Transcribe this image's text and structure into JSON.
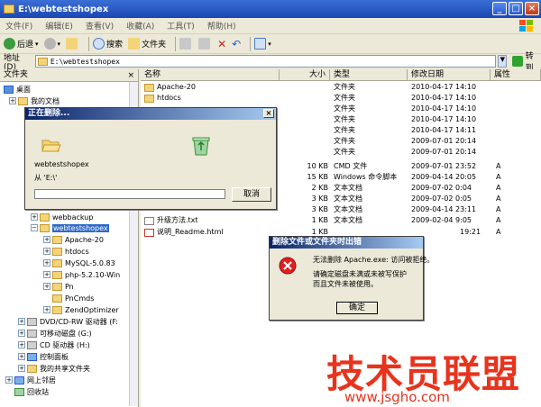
{
  "window": {
    "title": "E:\\webtestshopex"
  },
  "menu": [
    "文件(F)",
    "编辑(E)",
    "查看(V)",
    "收藏(A)",
    "工具(T)",
    "帮助(H)"
  ],
  "toolbar": {
    "back": "后退",
    "search": "搜索",
    "folders": "文件夹"
  },
  "address": {
    "label": "地址(D)",
    "value": "E:\\webtestshopex",
    "go": "转到"
  },
  "folders_pane": {
    "header": "文件夹",
    "items": [
      {
        "label": "桌面"
      },
      {
        "label": "我的文档"
      },
      {
        "label": "webbackup"
      },
      {
        "label": "webtestshopex"
      },
      {
        "label": "Apache-20"
      },
      {
        "label": "htdocs"
      },
      {
        "label": "MySQL-5.0.83"
      },
      {
        "label": "php-5.2.10-Win"
      },
      {
        "label": "Pn"
      },
      {
        "label": "PnCmds"
      },
      {
        "label": "ZendOptimizer"
      },
      {
        "label": "DVD/CD-RW 驱动器 (F:"
      },
      {
        "label": "可移动磁盘 (G:)"
      },
      {
        "label": "CD 驱动器 (H:)"
      },
      {
        "label": "控制面板"
      },
      {
        "label": "我的共享文件夹"
      },
      {
        "label": "网上邻居"
      },
      {
        "label": "回收站"
      }
    ]
  },
  "filelist": {
    "columns": {
      "name": "名称",
      "size": "大小",
      "type": "类型",
      "date": "修改日期",
      "attr": "属性"
    },
    "rows": [
      {
        "name": "Apache-20",
        "size": "",
        "type": "文件夹",
        "date": "2010-04-17 14:10",
        "attr": ""
      },
      {
        "name": "htdocs",
        "size": "",
        "type": "文件夹",
        "date": "2010-04-17 14:10",
        "attr": ""
      },
      {
        "name": "",
        "size": "",
        "type": "文件夹",
        "date": "2010-04-17 14:10",
        "attr": ""
      },
      {
        "name": "",
        "size": "",
        "type": "文件夹",
        "date": "2010-04-17 14:10",
        "attr": ""
      },
      {
        "name": "",
        "size": "",
        "type": "文件夹",
        "date": "2010-04-17 14:11",
        "attr": ""
      },
      {
        "name": "",
        "size": "",
        "type": "文件夹",
        "date": "2009-07-01 20:14",
        "attr": ""
      },
      {
        "name": "",
        "size": "",
        "type": "文件夹",
        "date": "2009-07-01 20:14",
        "attr": ""
      },
      {
        "name": "",
        "size": "10 KB",
        "type": "CMD 文件",
        "date": "2009-07-01 23:52",
        "attr": "A"
      },
      {
        "name": "",
        "size": "15 KB",
        "type": "Windows 命令脚本",
        "date": "2009-04-14 20:05",
        "attr": "A"
      },
      {
        "name": "",
        "size": "2 KB",
        "type": "文本文档",
        "date": "2009-07-02 0:04",
        "attr": "A"
      },
      {
        "name": "",
        "size": "3 KB",
        "type": "文本文档",
        "date": "2009-07-02 0:05",
        "attr": "A"
      },
      {
        "name": "",
        "size": "3 KB",
        "type": "文本文档",
        "date": "2009-04-14 23:11",
        "attr": "A"
      },
      {
        "name": "升级方法.txt",
        "size": "1 KB",
        "type": "文本文档",
        "date": "2009-02-04 9:05",
        "attr": "A"
      },
      {
        "name": "说明_Readme.html",
        "size": "1 KB",
        "type": "",
        "date": "19:21",
        "attr": "A"
      }
    ]
  },
  "delete_dialog": {
    "title": "正在删除...",
    "item": "webtestshopex",
    "from": "从 'E:\\'",
    "cancel": "取消"
  },
  "error_dialog": {
    "title": "删除文件或文件夹时出错",
    "line1": "无法删除 Apache.exe: 访问被拒绝。",
    "line2": "请确定磁盘未满或未被写保护",
    "line3": "而且文件未被使用。",
    "ok": "确定"
  },
  "watermark": {
    "text": "技术员联盟",
    "url": "www.jsgho.com"
  }
}
